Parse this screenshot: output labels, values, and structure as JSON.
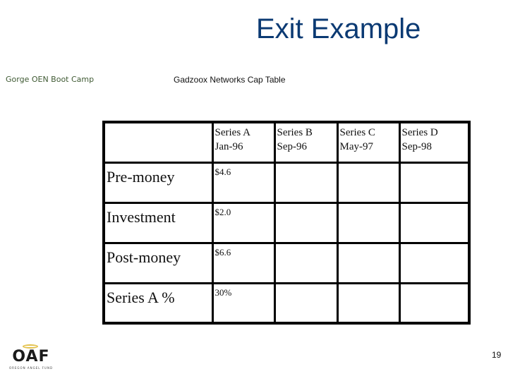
{
  "slide": {
    "title": "Exit Example",
    "header_left": "Gorge OEN Boot Camp",
    "table_caption": "Gadzoox Networks Cap Table",
    "page_number": "19"
  },
  "logo": {
    "icon": "halo-icon",
    "text": "OAF",
    "tagline": "OREGON ANGEL FUND"
  },
  "cap_table": {
    "columns": [
      {
        "series": "",
        "date": ""
      },
      {
        "series": "Series A",
        "date": "Jan-96"
      },
      {
        "series": "Series B",
        "date": "Sep-96"
      },
      {
        "series": "Series C",
        "date": "May-97"
      },
      {
        "series": "Series D",
        "date": "Sep-98"
      }
    ],
    "rows": [
      {
        "label": "Pre-money",
        "values": [
          "$4.6",
          "",
          "",
          ""
        ]
      },
      {
        "label": "Investment",
        "values": [
          "$2.0",
          "",
          "",
          ""
        ]
      },
      {
        "label": "Post-money",
        "values": [
          "$6.6",
          "",
          "",
          ""
        ]
      },
      {
        "label": "Series A %",
        "values": [
          "30%",
          "",
          "",
          ""
        ]
      }
    ]
  },
  "colors": {
    "title": "#0b3a73",
    "header_left": "#3f5a33",
    "logo_halo": "#e3c14a"
  }
}
